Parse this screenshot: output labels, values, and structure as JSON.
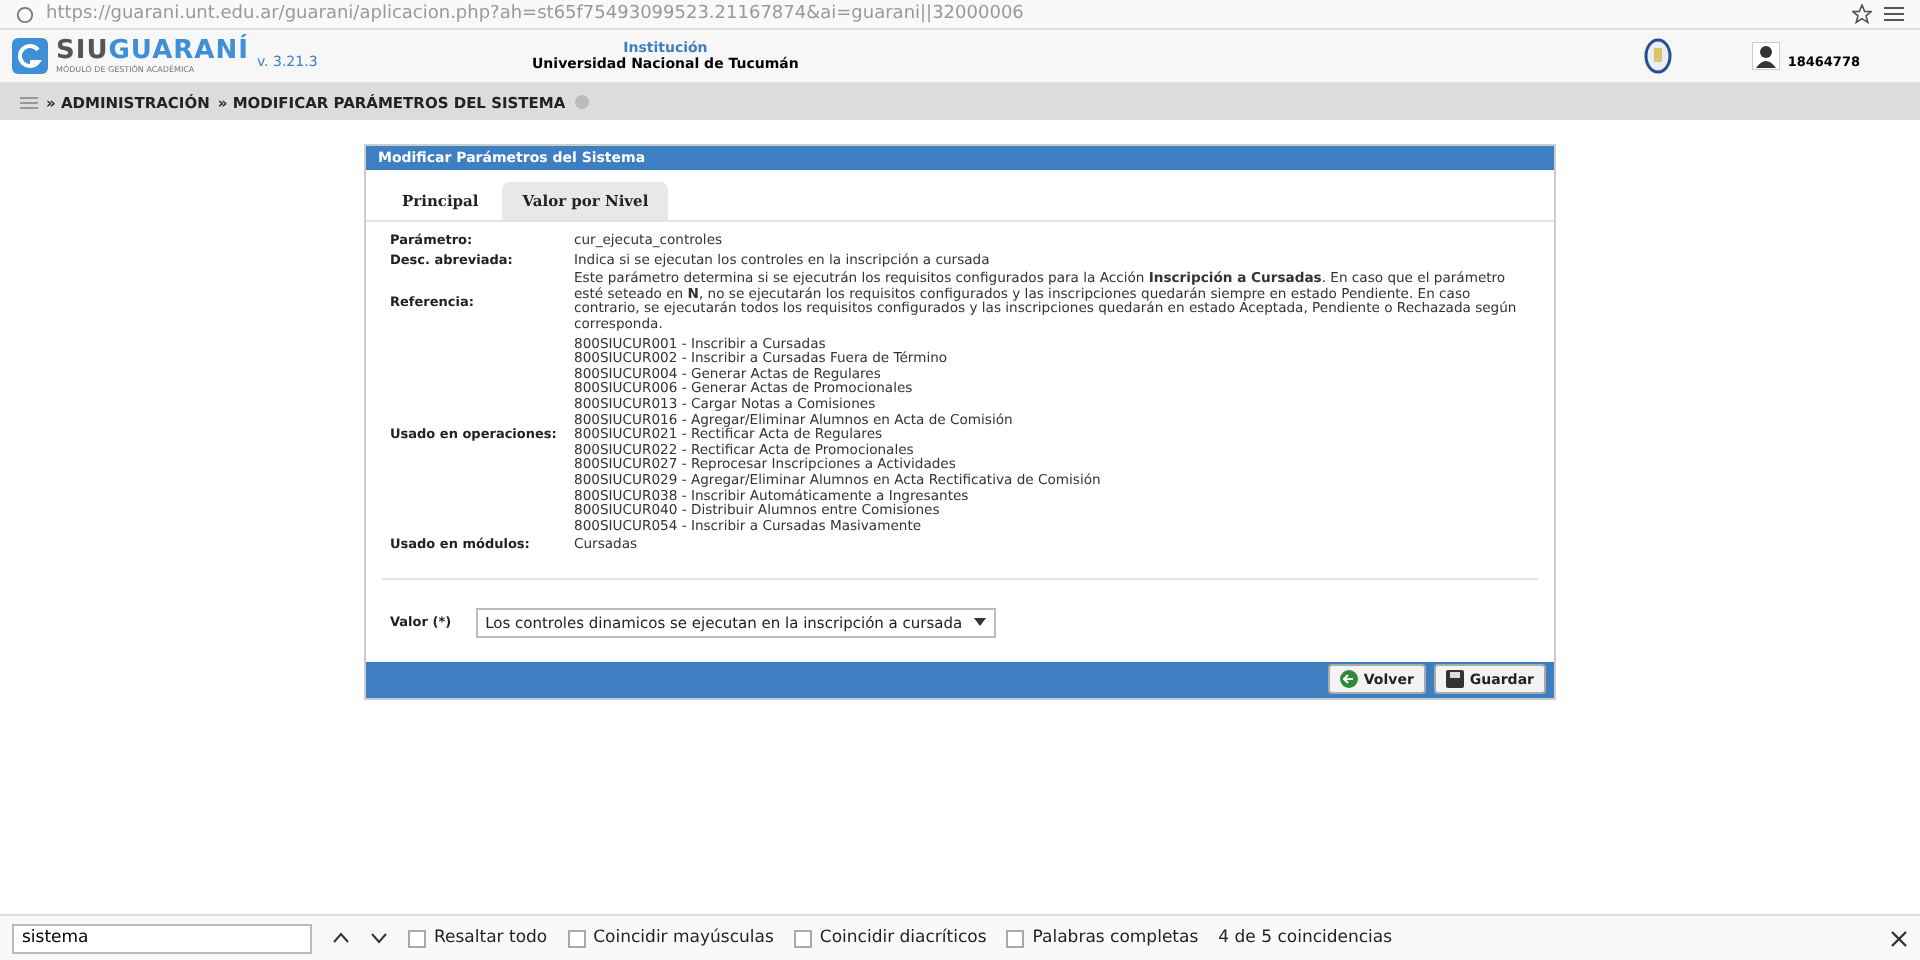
{
  "browser": {
    "url": "https://guarani.unt.edu.ar/guarani/aplicacion.php?ah=st65f75493099523.21167874&ai=guarani||32000006"
  },
  "header": {
    "logo_a": "SIU",
    "logo_b": "GUARANÍ",
    "logo_sub": "MÓDULO DE GESTIÓN ACADÉMICA",
    "version": "v. 3.21.3",
    "institution_label": "Institución",
    "institution": "Universidad Nacional de Tucumán",
    "user": "18464778"
  },
  "breadcrumb": [
    {
      "label": "» ADMINISTRACIÓN"
    },
    {
      "label": "» MODIFICAR PARÁMETROS DEL SISTEMA"
    }
  ],
  "panel": {
    "title": "Modificar Parámetros del Sistema",
    "tabs": [
      {
        "label": "Principal",
        "selected": true
      },
      {
        "label": "Valor por Nivel",
        "selected": false
      }
    ],
    "fields": [
      {
        "label": "Parámetro:",
        "value": "cur_ejecuta_controles"
      },
      {
        "label": "Desc. abreviada:",
        "value": "Indica si se ejecutan los controles en la inscripción a cursada"
      },
      {
        "label": "Referencia:",
        "value": "Este parámetro determina si se ejecutrán los requisitos configurados para la Acción **Inscripción a Cursadas**. En caso que el parámetro esté seteado en **N**, no se ejecutarán los requisitos configurados y las inscripciones quedarán siempre en estado Pendiente. En caso contrario, se ejecutarán todos los requisitos configurados y las inscripciones quedarán en estado Aceptada, Pendiente o Rechazada según corresponda."
      }
    ],
    "operations_label": "Usado en operaciones:",
    "operations": [
      "800SIUCUR001 - Inscribir a Cursadas",
      "800SIUCUR002 - Inscribir a Cursadas Fuera de Término",
      "800SIUCUR004 - Generar Actas de Regulares",
      "800SIUCUR006 - Generar Actas de Promocionales",
      "800SIUCUR013 - Cargar Notas a Comisiones",
      "800SIUCUR016 - Agregar/Eliminar Alumnos en Acta de Comisión",
      "800SIUCUR021 - Rectificar Acta de Regulares",
      "800SIUCUR022 - Rectificar Acta de Promocionales",
      "800SIUCUR027 - Reprocesar Inscripciones a Actividades",
      "800SIUCUR029 - Agregar/Eliminar Alumnos en Acta Rectificativa de Comisión",
      "800SIUCUR038 - Inscribir Automáticamente a Ingresantes",
      "800SIUCUR040 - Distribuir Alumnos entre Comisiones",
      "800SIUCUR054 - Inscribir a Cursadas Masivamente"
    ],
    "modules_label": "Usado en módulos:",
    "modules": "Cursadas",
    "value_label": "Valor (*)",
    "value": "Los controles dinamicos se ejecutan en la inscripción a cursada",
    "buttons": [
      {
        "kind": "back",
        "label": "Volver"
      },
      {
        "kind": "save",
        "label": "Guardar"
      }
    ]
  },
  "find_bar": {
    "query": "sistema",
    "options": [
      {
        "label": "Resaltar todo",
        "checked": false
      },
      {
        "label": "Coincidir mayúsculas",
        "checked": false
      },
      {
        "label": "Coincidir diacríticos",
        "checked": false
      },
      {
        "label": "Palabras completas",
        "checked": false
      }
    ],
    "status": "4 de 5 coincidencias"
  }
}
